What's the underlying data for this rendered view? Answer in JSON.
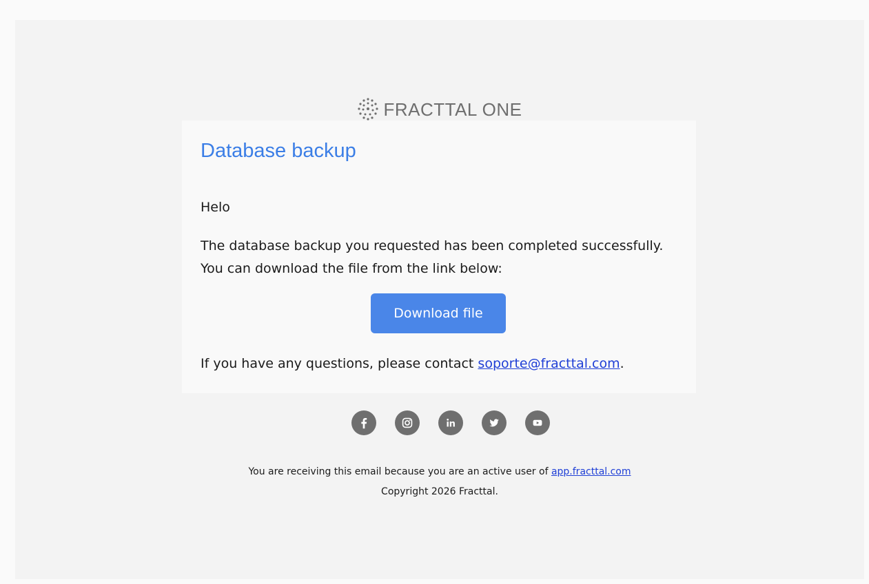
{
  "brand": {
    "logo_text": "FRACTTAL ONE",
    "logo_icon": "dotted-circle-icon"
  },
  "email": {
    "title": "Database backup",
    "greeting": "Helo",
    "message_line1": "The database backup you requested has been completed successfully.",
    "message_line2": "You can download the file from the link below:",
    "download_label": "Download file",
    "contact_prefix": "If you have any questions, please contact ",
    "contact_email": "soporte@fracttal.com",
    "contact_suffix": "."
  },
  "social": [
    {
      "name": "facebook-icon"
    },
    {
      "name": "instagram-icon"
    },
    {
      "name": "linkedin-icon"
    },
    {
      "name": "twitter-icon"
    },
    {
      "name": "youtube-icon"
    }
  ],
  "footer": {
    "notice_prefix": "You are receiving this email because you are an active user of ",
    "notice_link": "app.fracttal.com",
    "copyright": "Copyright 2026 Fracttal."
  },
  "colors": {
    "accent": "#4a86e8",
    "title": "#3b7ee6",
    "link": "#1f3fd6",
    "icon_gray": "#6f6f6f"
  }
}
